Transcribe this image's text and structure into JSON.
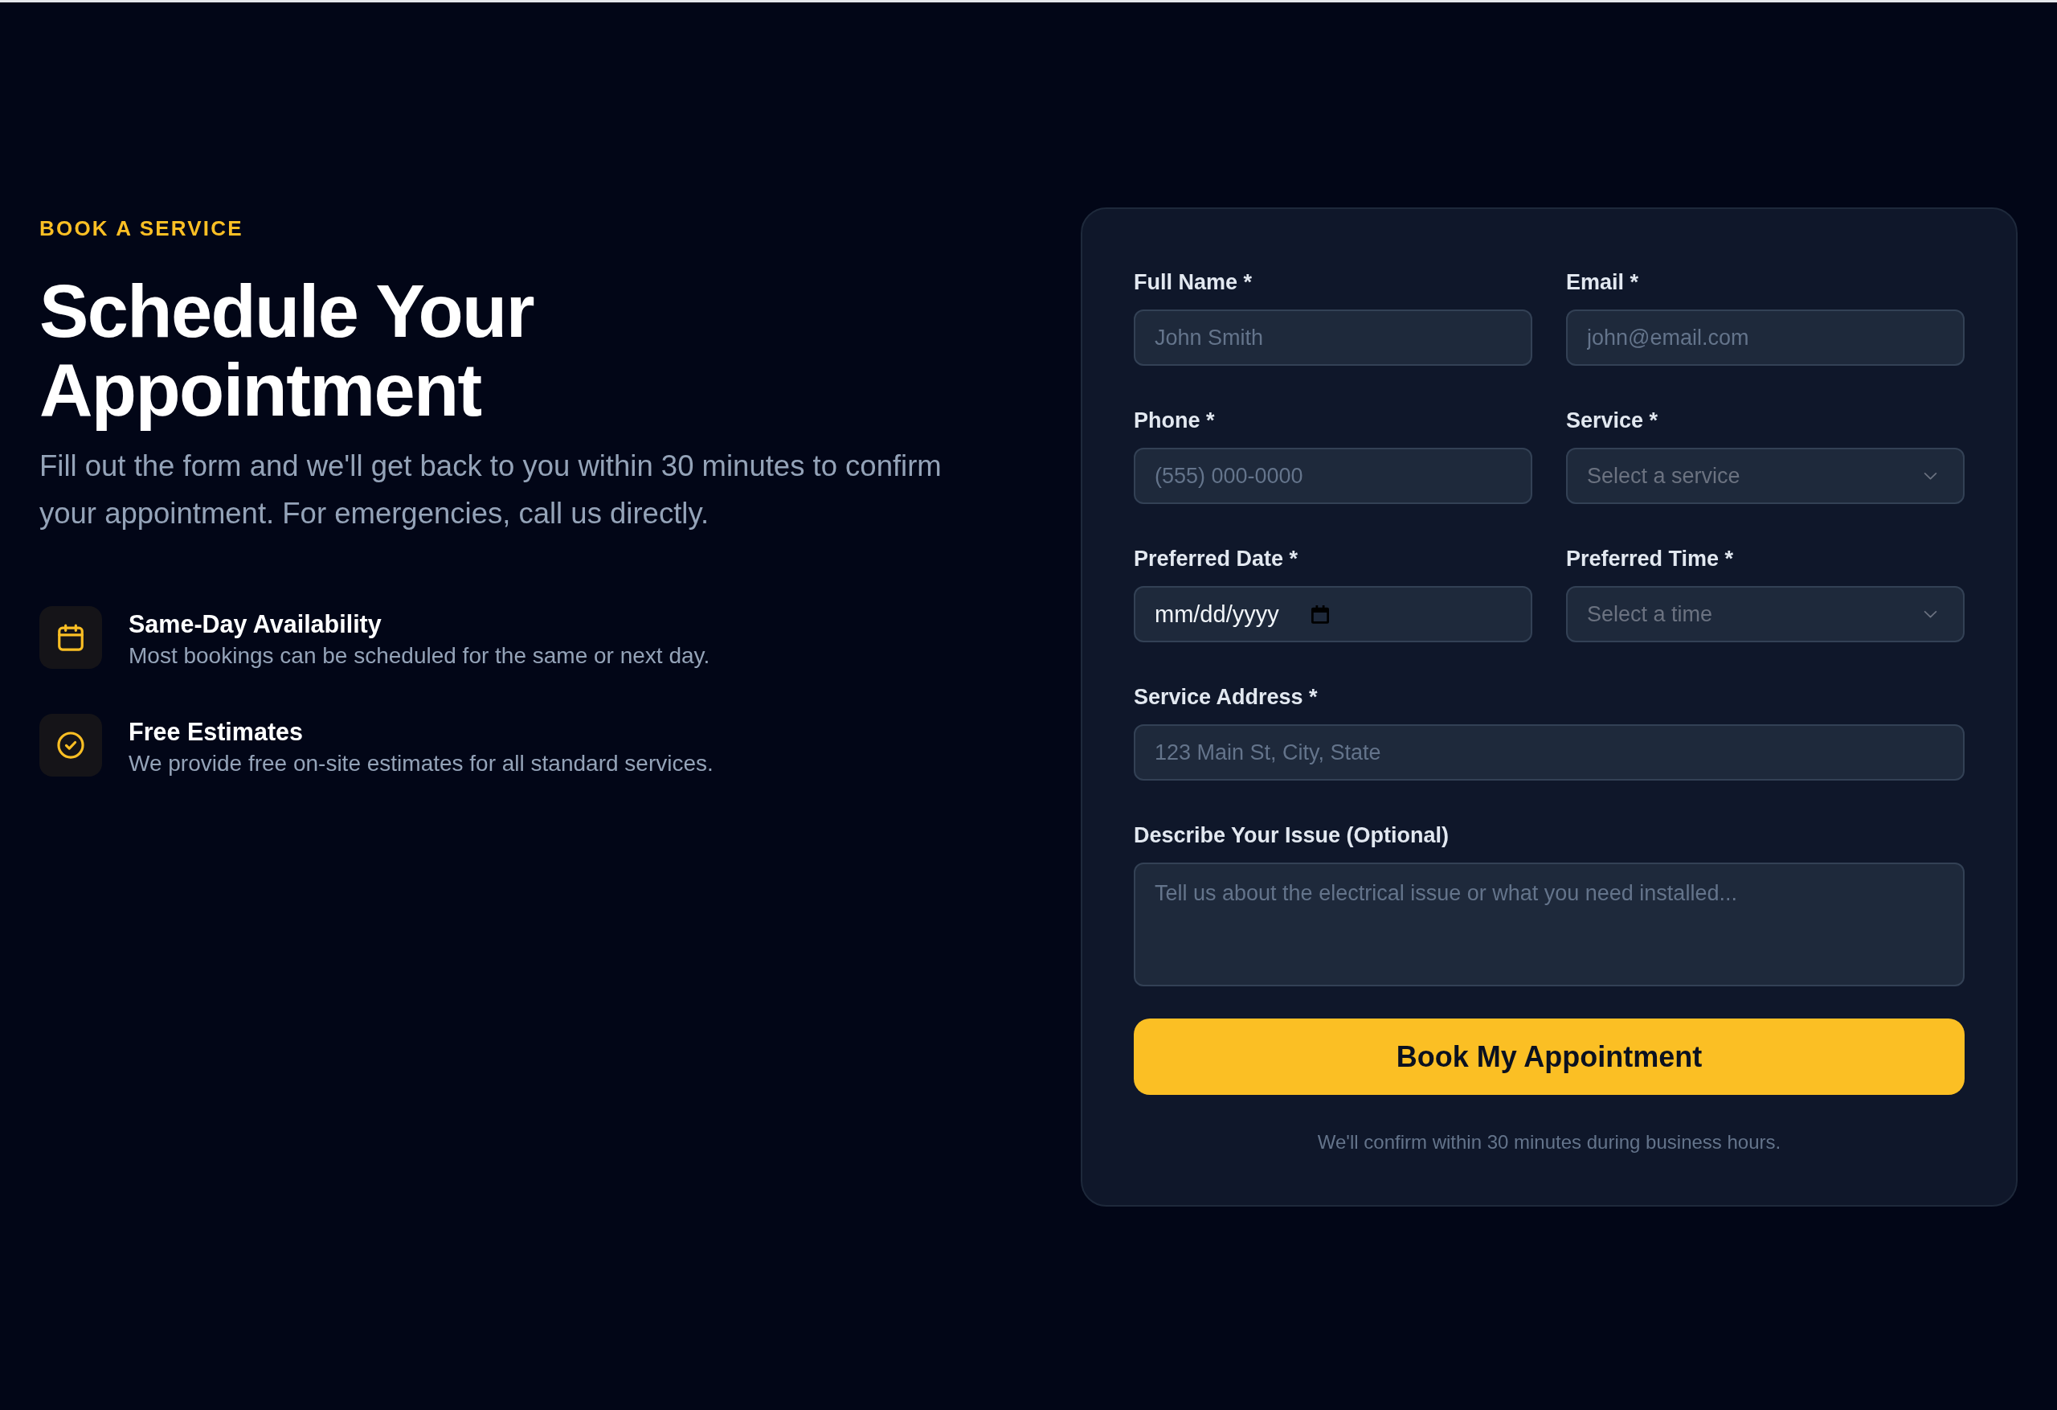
{
  "intro": {
    "eyebrow": "BOOK A SERVICE",
    "title": "Schedule Your Appointment",
    "text": "Fill out the form and we'll get back to you within 30 minutes to confirm your appointment. For emergencies, call us directly."
  },
  "features": [
    {
      "title": "Same-Day Availability",
      "text": "Most bookings can be scheduled for the same or next day."
    },
    {
      "title": "Free Estimates",
      "text": "We provide free on-site estimates for all standard services."
    }
  ],
  "form": {
    "rows": [
      [
        {
          "label": "Full Name *",
          "kind": "text",
          "placeholder": "John Smith"
        },
        {
          "label": "Email *",
          "kind": "text",
          "placeholder": "john@email.com"
        }
      ],
      [
        {
          "label": "Phone *",
          "kind": "text",
          "placeholder": "(555) 000-0000"
        },
        {
          "label": "Service *",
          "kind": "select",
          "placeholder": "Select a service"
        }
      ],
      [
        {
          "label": "Preferred Date *",
          "kind": "date",
          "placeholder": "mm/dd/yyyy"
        },
        {
          "label": "Preferred Time *",
          "kind": "select",
          "placeholder": "Select a time"
        }
      ],
      [
        {
          "label": "Service Address *",
          "kind": "text",
          "placeholder": "123 Main St, City, State"
        }
      ],
      [
        {
          "label": "Describe Your Issue (Optional)",
          "kind": "textarea",
          "placeholder": "Tell us about the electrical issue or what you need installed..."
        }
      ]
    ],
    "submit": "Book My Appointment",
    "note": "We'll confirm within 30 minutes during business hours."
  }
}
